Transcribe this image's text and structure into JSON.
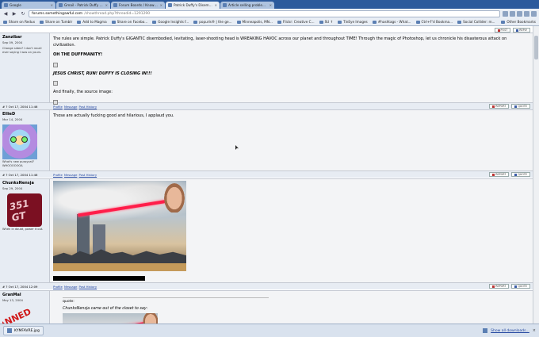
{
  "browser": {
    "tabs": [
      {
        "title": "Google",
        "active": false
      },
      {
        "title": "Gmail - Patrick Duffy and...",
        "active": false
      },
      {
        "title": "Forum Boards / Know Yo...",
        "active": false
      },
      {
        "title": "Patrick Duffy's Disembod...",
        "active": true
      },
      {
        "title": "Article selling problem?...",
        "active": false
      }
    ],
    "url_host": "forums.somethingawful.com",
    "url_path": "/showthread.php?threadid=1291290",
    "bookmarks": [
      "Share on Redux",
      "Share on Tumblr",
      "Add to Magma",
      "Share on Facebo...",
      "Google Insights f...",
      "popurls® | the ge...",
      "Minneapolis, MN...",
      "Flickr: Creative C...",
      "SU ↑",
      "TinEye Images",
      "#hashtags - What...",
      "Ctrl+F'd Bookma...",
      "Social Collider: m..."
    ],
    "other_bookmarks": "Other Bookmarks"
  },
  "posts": [
    {
      "author": "Zanzibar",
      "regdate": "Sep 09, 2004",
      "usertitle": "Change sides? I don't recall ever saying I was on yours.",
      "paragraphs": [
        "The rules are simple. Patrick Duffy's GIGANTIC disembodied, levitating, laser-shooting head is WREAKING HAVOC across our planet and throughout TIME! Through the magic of Photoshop, let us chronicle his disasterous attack on civilization.",
        "OH THE DUFFMANITY!",
        "JESUS CHRIST, RUN! DUFFY IS CLOSING IN!!!",
        "And finally, the source image:"
      ],
      "date": "# ? Oct 17, 2004 11:46"
    },
    {
      "author": "EllieD",
      "regdate": "Mar 14, 2004",
      "usertitle": "What's new pussycat? WHOOOOOOA",
      "text": "Those are actually fucking good and hilarious, I applaud you.",
      "date": "# ? Oct 17, 2004 11:46"
    },
    {
      "author": "ChunksNensja",
      "regdate": "Sep 29, 2004",
      "avatar_text": "351 GT",
      "usertitle": "When in doubt, power it out.",
      "date": "# ? Oct 17, 2004 12:09"
    },
    {
      "author": "GranMal",
      "regdate": "May 13, 2004",
      "avatar_text": "ANNED",
      "quote_label": "quote:",
      "quote_head": "ChunksNensja came out of the closet to say:"
    }
  ],
  "post_actions": {
    "profile": "Profile",
    "message": "Message",
    "history": "Post History",
    "report": "REPORT",
    "quote": "QUOTE"
  },
  "top_actions": {
    "post": "POST",
    "reply": "REPLY"
  },
  "downloads": {
    "file": "KYMFAVRE.jpg",
    "show_all": "Show all downloads..."
  },
  "colors": {
    "accent": "#2c5a9c",
    "userinfo_bg": "#e7ecf3",
    "post_bg": "#f3f4f6",
    "laser": "#ff1e4a"
  }
}
